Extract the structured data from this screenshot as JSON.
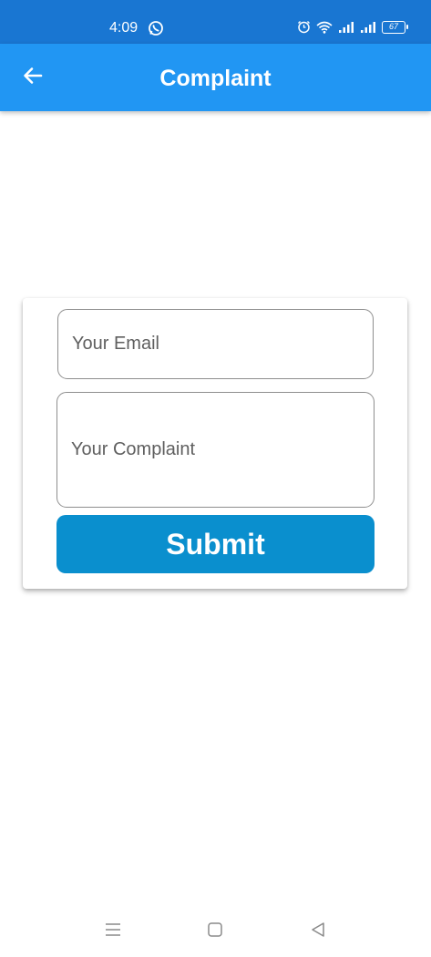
{
  "status_bar": {
    "time": "4:09",
    "battery": "67",
    "icons": [
      "whatsapp-icon",
      "alarm-icon",
      "wifi-icon",
      "signal-icon",
      "signal-icon",
      "battery-icon"
    ]
  },
  "app_bar": {
    "title": "Complaint",
    "back_icon": "arrow-left-icon",
    "color": "#2196F3"
  },
  "form": {
    "email_placeholder": "Your Email",
    "complaint_placeholder": "Your Complaint",
    "submit_label": "Submit",
    "submit_color": "#0A8FCE"
  },
  "nav_bar": {
    "icons": [
      "menu-icon",
      "home-icon",
      "back-triangle-icon"
    ]
  }
}
